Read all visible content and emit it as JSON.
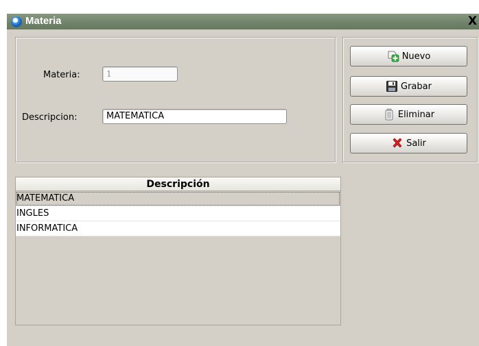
{
  "window": {
    "title": "Materia",
    "close_glyph": "X"
  },
  "form": {
    "materia_label": "Materia:",
    "materia_value": "1",
    "descripcion_label": "Descripcion:",
    "descripcion_value": "MATEMATICA"
  },
  "buttons": {
    "nuevo": "Nuevo",
    "grabar": "Grabar",
    "eliminar": "Eliminar",
    "salir": "Salir"
  },
  "icons": {
    "app": "app-globe-icon",
    "nuevo": "add-document-icon",
    "grabar": "floppy-disk-icon",
    "eliminar": "trash-bin-icon",
    "salir": "red-x-icon"
  },
  "table": {
    "header": "Descripción",
    "rows": [
      "MATEMATICA",
      "INGLES",
      "INFORMATICA"
    ],
    "selected_index": 0
  },
  "colors": {
    "titlebar": "#6f8269",
    "window_bg": "#d4d0c8",
    "add_icon": "#3bb143",
    "exit_icon": "#d42020"
  }
}
